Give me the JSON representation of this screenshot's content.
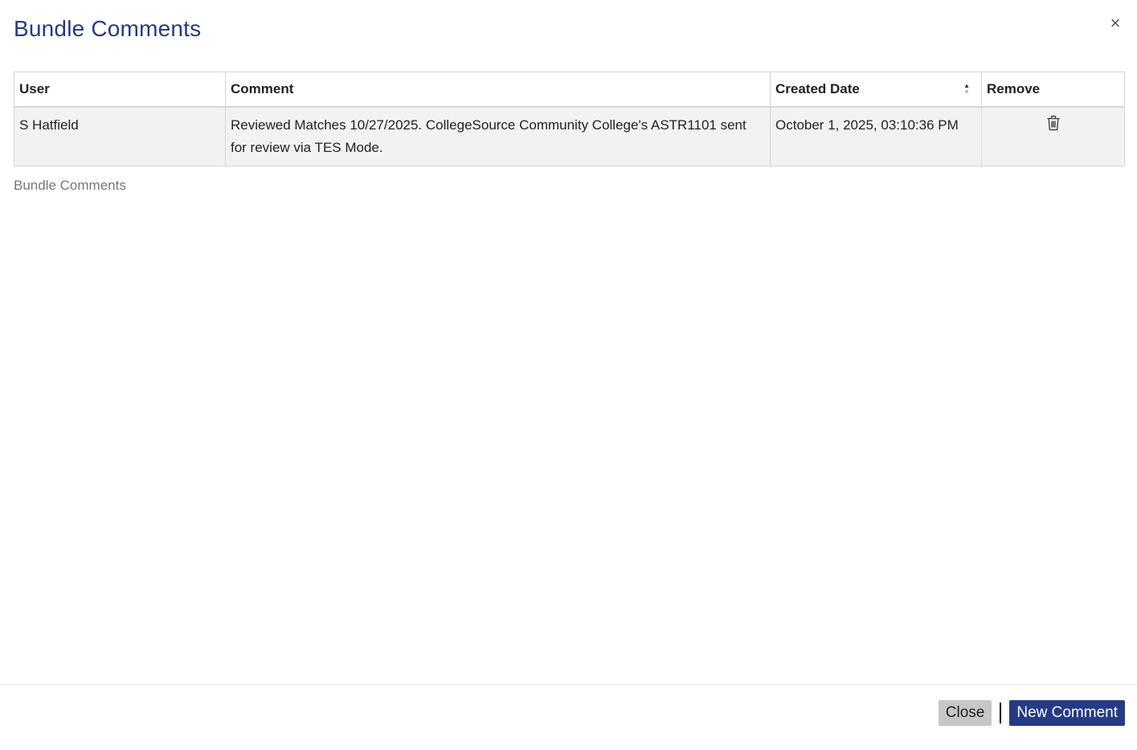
{
  "modal": {
    "title": "Bundle Comments",
    "close_icon": "close-icon"
  },
  "table": {
    "columns": [
      {
        "label": "User"
      },
      {
        "label": "Comment"
      },
      {
        "label": "Created Date",
        "sortable": true
      },
      {
        "label": "Remove"
      }
    ],
    "rows": [
      {
        "user": "S Hatfield",
        "comment": "Reviewed Matches 10/27/2025. CollegeSource Community College's ASTR1101 sent for review via TES Mode.",
        "created_date": "October 1, 2025, 03:10:36 PM",
        "remove_icon": "trash-icon"
      }
    ]
  },
  "section": {
    "label": "Bundle Comments"
  },
  "footer": {
    "close_label": "Close",
    "new_comment_label": "New Comment"
  },
  "colors": {
    "accent": "#263a85",
    "row_bg": "#f2f2f2",
    "close_button_bg": "#c5c7c8"
  }
}
